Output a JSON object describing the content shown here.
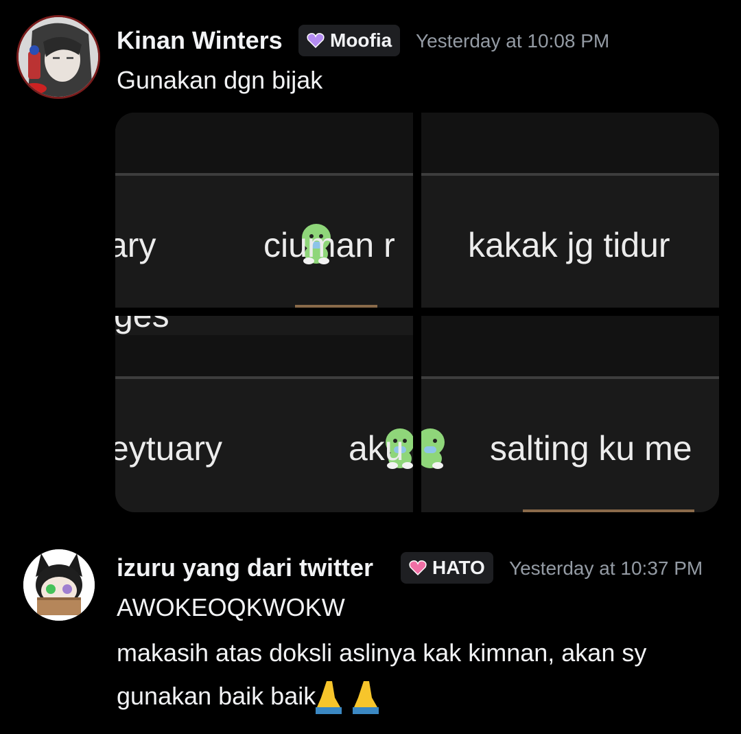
{
  "messages": [
    {
      "username": "Kinan Winters",
      "tag": {
        "label": "Moofia",
        "color": "#b48cf0"
      },
      "timestamp": "Yesterday at 10:08 PM",
      "lines": [
        "Gunakan dgn bijak"
      ],
      "attachments": {
        "tiles": [
          {
            "captions": [
              "ary",
              "ciuman r"
            ]
          },
          {
            "captions": [
              "kakak jg tidur"
            ]
          },
          {
            "captions": [
              "ges",
              "eytuary",
              "aku"
            ]
          },
          {
            "captions": [
              "salting ku me"
            ]
          }
        ]
      }
    },
    {
      "username": "izuru yang dari twitter",
      "tag": {
        "label": "HATO",
        "color": "#f06fa5"
      },
      "timestamp": "Yesterday at 10:37 PM",
      "lines": [
        "AWOKEOQKWOKW",
        "makasih atas doksli aslinya kak kimnan, akan sy",
        "gunakan baik baik"
      ],
      "emoji": "folded-hands-icon"
    }
  ]
}
